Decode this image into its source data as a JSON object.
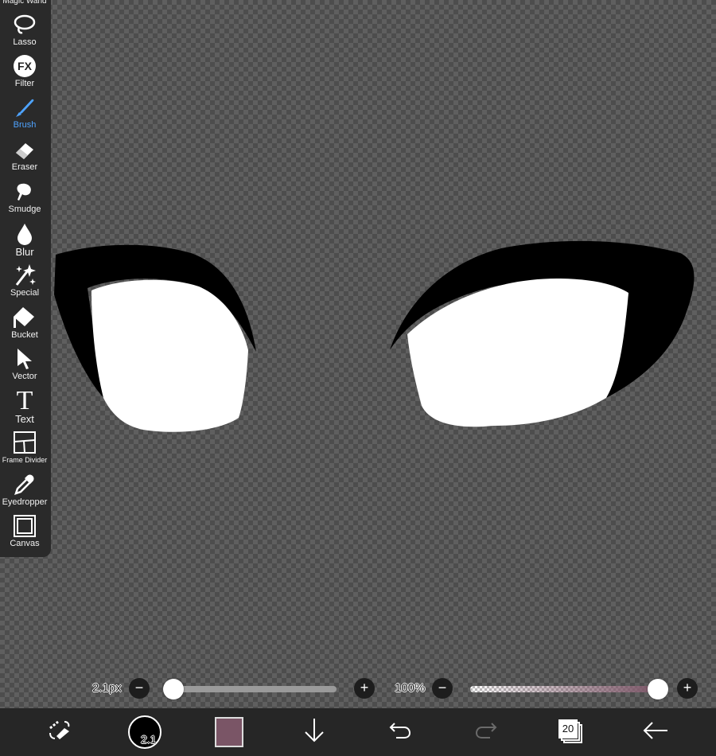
{
  "toolbar": {
    "items": [
      {
        "label": "Magic Wand",
        "icon": "magic-wand-icon"
      },
      {
        "label": "Lasso",
        "icon": "lasso-icon"
      },
      {
        "label": "Filter",
        "icon": "fx-icon"
      },
      {
        "label": "Brush",
        "icon": "brush-icon",
        "active": true
      },
      {
        "label": "Eraser",
        "icon": "eraser-icon"
      },
      {
        "label": "Smudge",
        "icon": "smudge-icon"
      },
      {
        "label": "Blur",
        "icon": "blur-drop-icon"
      },
      {
        "label": "Special",
        "icon": "sparkle-icon"
      },
      {
        "label": "Bucket",
        "icon": "bucket-icon"
      },
      {
        "label": "Vector",
        "icon": "cursor-arrow-icon"
      },
      {
        "label": "Text",
        "icon": "text-t-icon"
      },
      {
        "label": "Frame Divider",
        "icon": "frame-divider-icon"
      },
      {
        "label": "Eyedropper",
        "icon": "eyedropper-icon"
      },
      {
        "label": "Canvas",
        "icon": "canvas-icon"
      }
    ],
    "fx_glyph": "FX",
    "text_glyph": "T",
    "active_color": "#4ea3ff"
  },
  "brush_size": {
    "value": "2.1px",
    "level": 0.0,
    "minus": "−",
    "plus": "+"
  },
  "opacity": {
    "value": "100%",
    "level": 1.0,
    "minus": "−",
    "plus": "+"
  },
  "bottom_bar": {
    "brush_preview_label": "2.1",
    "current_color": "#7a5566",
    "layer_count": "20"
  }
}
